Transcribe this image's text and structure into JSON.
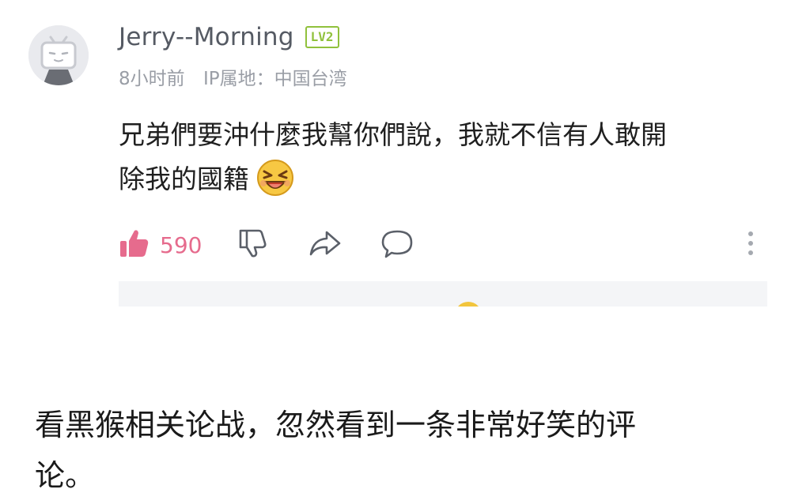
{
  "comment": {
    "username": "Jerry--Morning",
    "level_badge": "LV2",
    "time_ago": "8小时前",
    "ip_location": "IP属地：中国台湾",
    "text_line1": "兄弟們要沖什麼我幫你們說，我就不信有人敢開",
    "text_line2": "除我的國籍",
    "emoji": "laughing-face-emoji",
    "likes": "590",
    "colors": {
      "like_accent": "#e66b8d",
      "level_badge": "#90c13c"
    }
  },
  "caption": {
    "line1": "看黑猴相关论战，忽然看到一条非常好笑的评",
    "line2": "论。"
  }
}
